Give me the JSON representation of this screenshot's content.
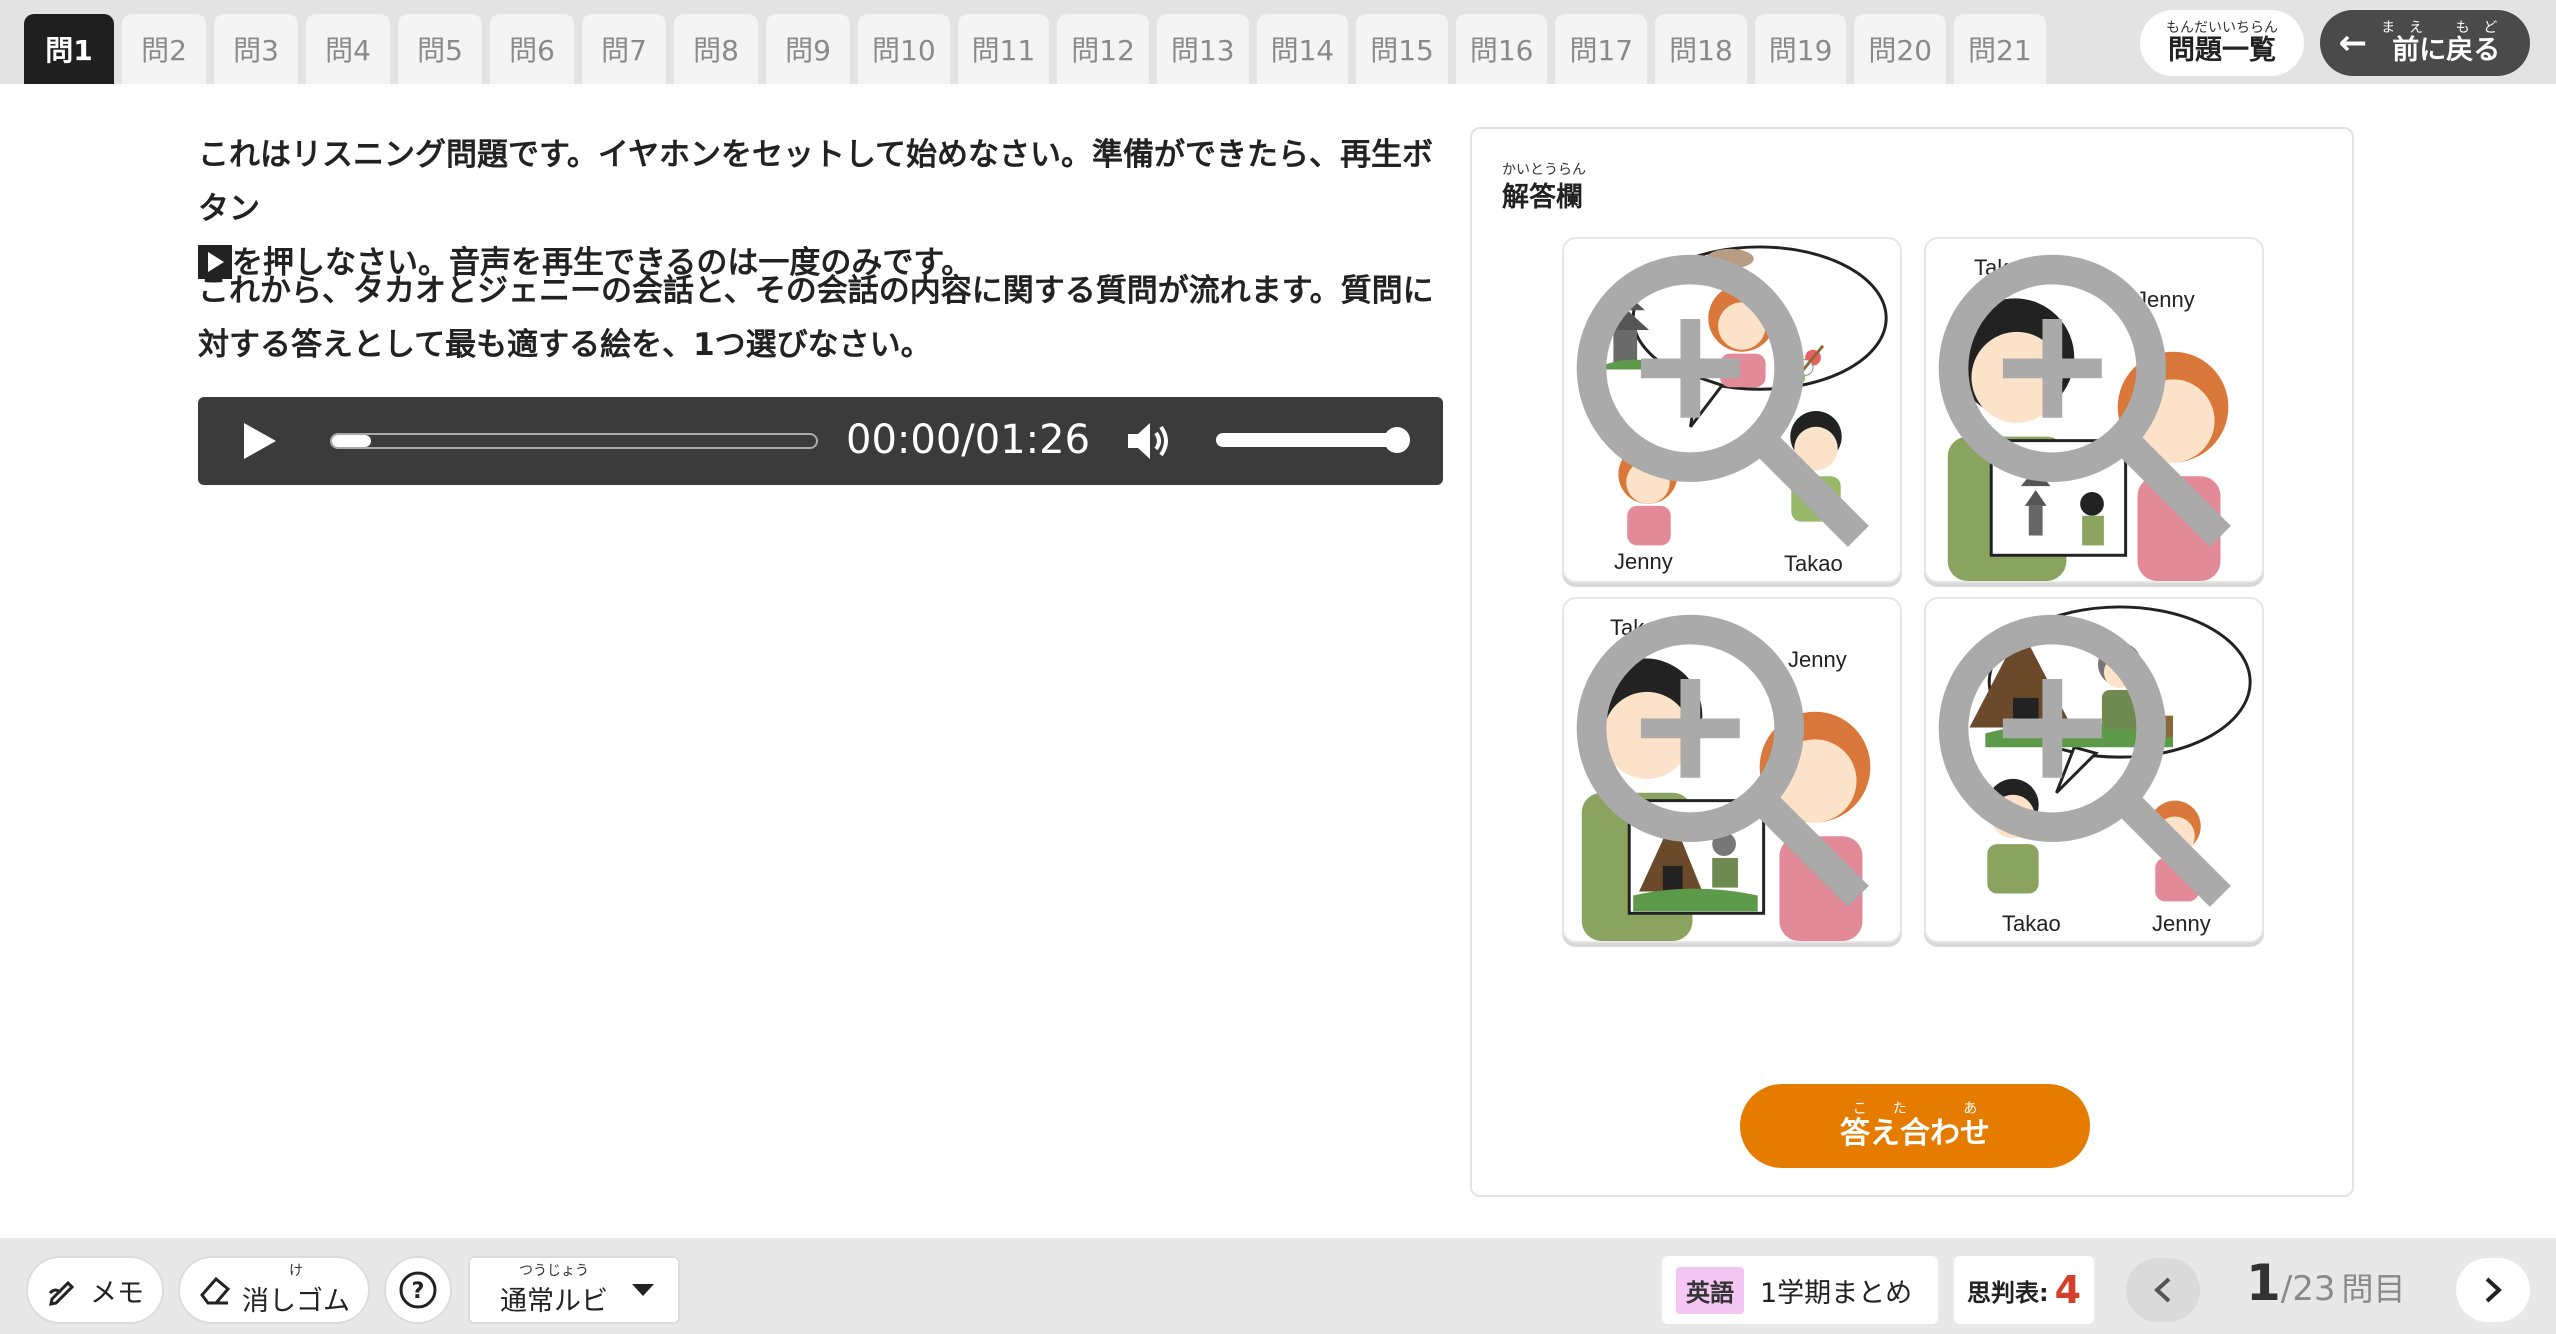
{
  "tabs": [
    "問1",
    "問2",
    "問3",
    "問4",
    "問5",
    "問6",
    "問7",
    "問8",
    "問9",
    "問10",
    "問11",
    "問12",
    "問13",
    "問14",
    "問15",
    "問16",
    "問17",
    "問18",
    "問19",
    "問20",
    "問21"
  ],
  "active_tab": "問1",
  "header": {
    "list_ruby": "もんだいいちらん",
    "list_label": "問題一覧",
    "back_ruby": "まえ もど",
    "back_label": "前に戻る"
  },
  "question": {
    "para1_a": "これはリスニング問題です。イヤホンをセットして始めなさい。準備ができたら、再生ボタン",
    "para1_b": "を押しなさい。音声を再生できるのは一度のみです。",
    "para2": "これから、タカオとジェニーの会話と、その会話の内容に関する質問が流れます。質問に対する答えとして最も適する絵を、1つ選びなさい。"
  },
  "player": {
    "time": "00:00/01:26",
    "progress": 0.08,
    "volume": 1.0
  },
  "answer_panel": {
    "title_ruby": "かいとうらん",
    "title": "解答欄",
    "choices": [
      {
        "names": [
          "Jenny",
          "Takao"
        ],
        "scene": "temple-dango-thought"
      },
      {
        "names": [
          "Takao",
          "Jenny"
        ],
        "scene": "photo-temple"
      },
      {
        "names": [
          "Takao",
          "Jenny"
        ],
        "scene": "photo-camping"
      },
      {
        "names": [
          "Takao",
          "Jenny"
        ],
        "scene": "camping-thought"
      }
    ],
    "check_ruby": "こた あ",
    "check_label": "答え合わせ"
  },
  "bottom": {
    "memo_label": "メモ",
    "eraser_ruby": "け",
    "eraser_label": "消しゴム",
    "help_label": "?",
    "ruby_mode_ruby": "つうじょう",
    "ruby_mode_label": "通常ルビ",
    "subject_tag": "英語",
    "subject_name": "1学期まとめ",
    "shihan_label": "思判表:",
    "shihan_value": "4",
    "page_current": "1",
    "page_total": "/23",
    "page_unit": "問目"
  },
  "colors": {
    "accent_orange": "#e57c00",
    "dark_tab": "#1f1f1f",
    "player_bg": "#3b3b3b",
    "shihan_red": "#d6402a",
    "subject_tag_bg": "#f3c6f3"
  }
}
